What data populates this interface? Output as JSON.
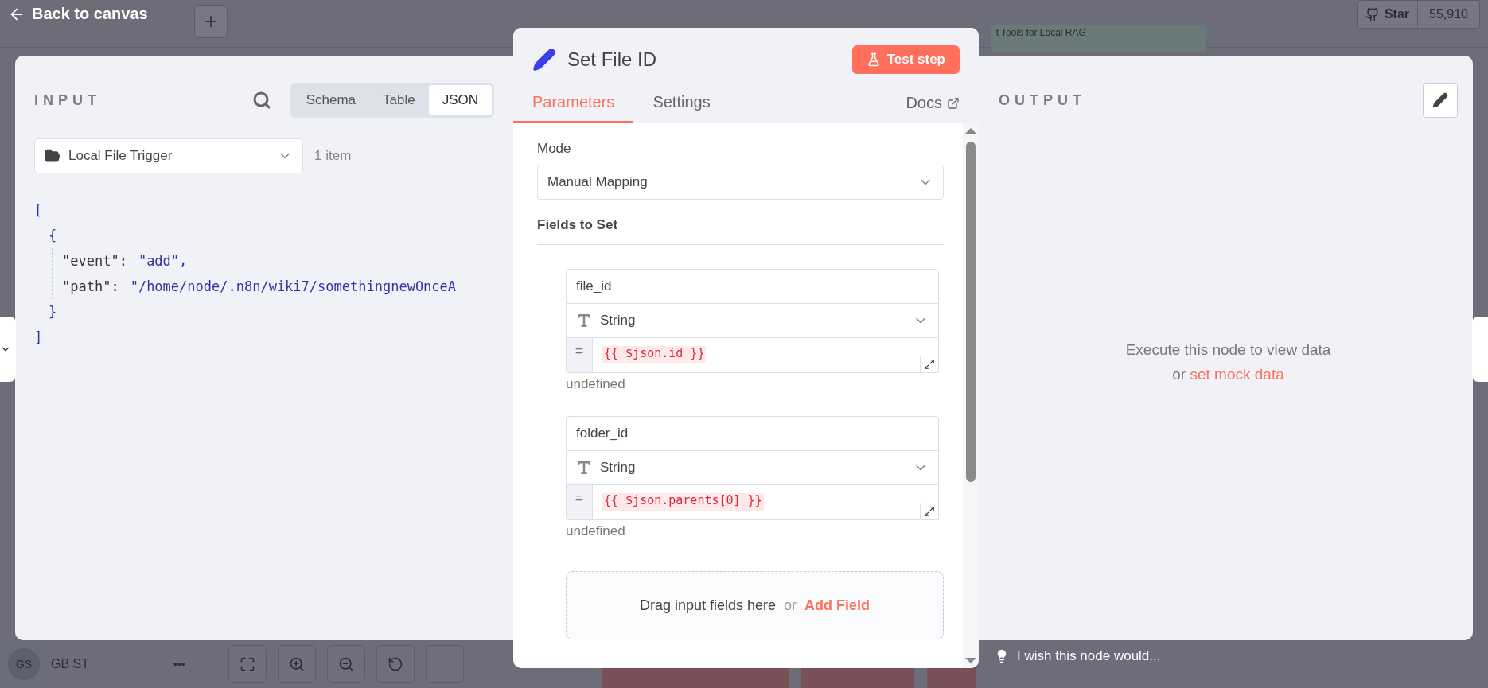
{
  "background": {
    "back_link": "Back to canvas",
    "workflow_name": "t Tools for Local RAG",
    "github": {
      "label": "Star",
      "count": "55,910"
    },
    "user": {
      "initials": "GS",
      "name": "GB ST"
    },
    "more": "•••"
  },
  "input": {
    "title": "INPUT",
    "views": [
      {
        "label": "Schema",
        "selected": false
      },
      {
        "label": "Table",
        "selected": false
      },
      {
        "label": "JSON",
        "selected": true
      }
    ],
    "source": "Local File Trigger",
    "item_count": "1 item",
    "json_view": {
      "open": "[",
      "close": "]",
      "children": [
        {
          "open": "{",
          "close": "}",
          "fields": [
            {
              "key": "\"event\":",
              "value": "\"add\","
            },
            {
              "key": "\"path\":",
              "value": "\"/home/node/.n8n/wiki7/somethingnewOnceA"
            }
          ]
        }
      ]
    }
  },
  "node": {
    "title": "Set File ID",
    "test_button": "Test step",
    "tabs": [
      {
        "label": "Parameters",
        "selected": true
      },
      {
        "label": "Settings",
        "selected": false
      }
    ],
    "docs": "Docs",
    "mode_label": "Mode",
    "mode": "Manual Mapping",
    "fields_title": "Fields to Set",
    "assignments": [
      {
        "name": "file_id",
        "type": "String",
        "operator": "=",
        "value": "{{ $json.id }}",
        "hint": "undefined"
      },
      {
        "name": "folder_id",
        "type": "String",
        "operator": "=",
        "value": "{{ $json.parents[0] }}",
        "hint": "undefined"
      }
    ],
    "drop_zone": {
      "text": "Drag input fields here",
      "separator": "or",
      "link": "Add Field"
    }
  },
  "output": {
    "title": "OUTPUT",
    "message": "Execute this node to view data",
    "separator": "or",
    "link": "set mock data"
  },
  "feedback": "I wish this node would..."
}
